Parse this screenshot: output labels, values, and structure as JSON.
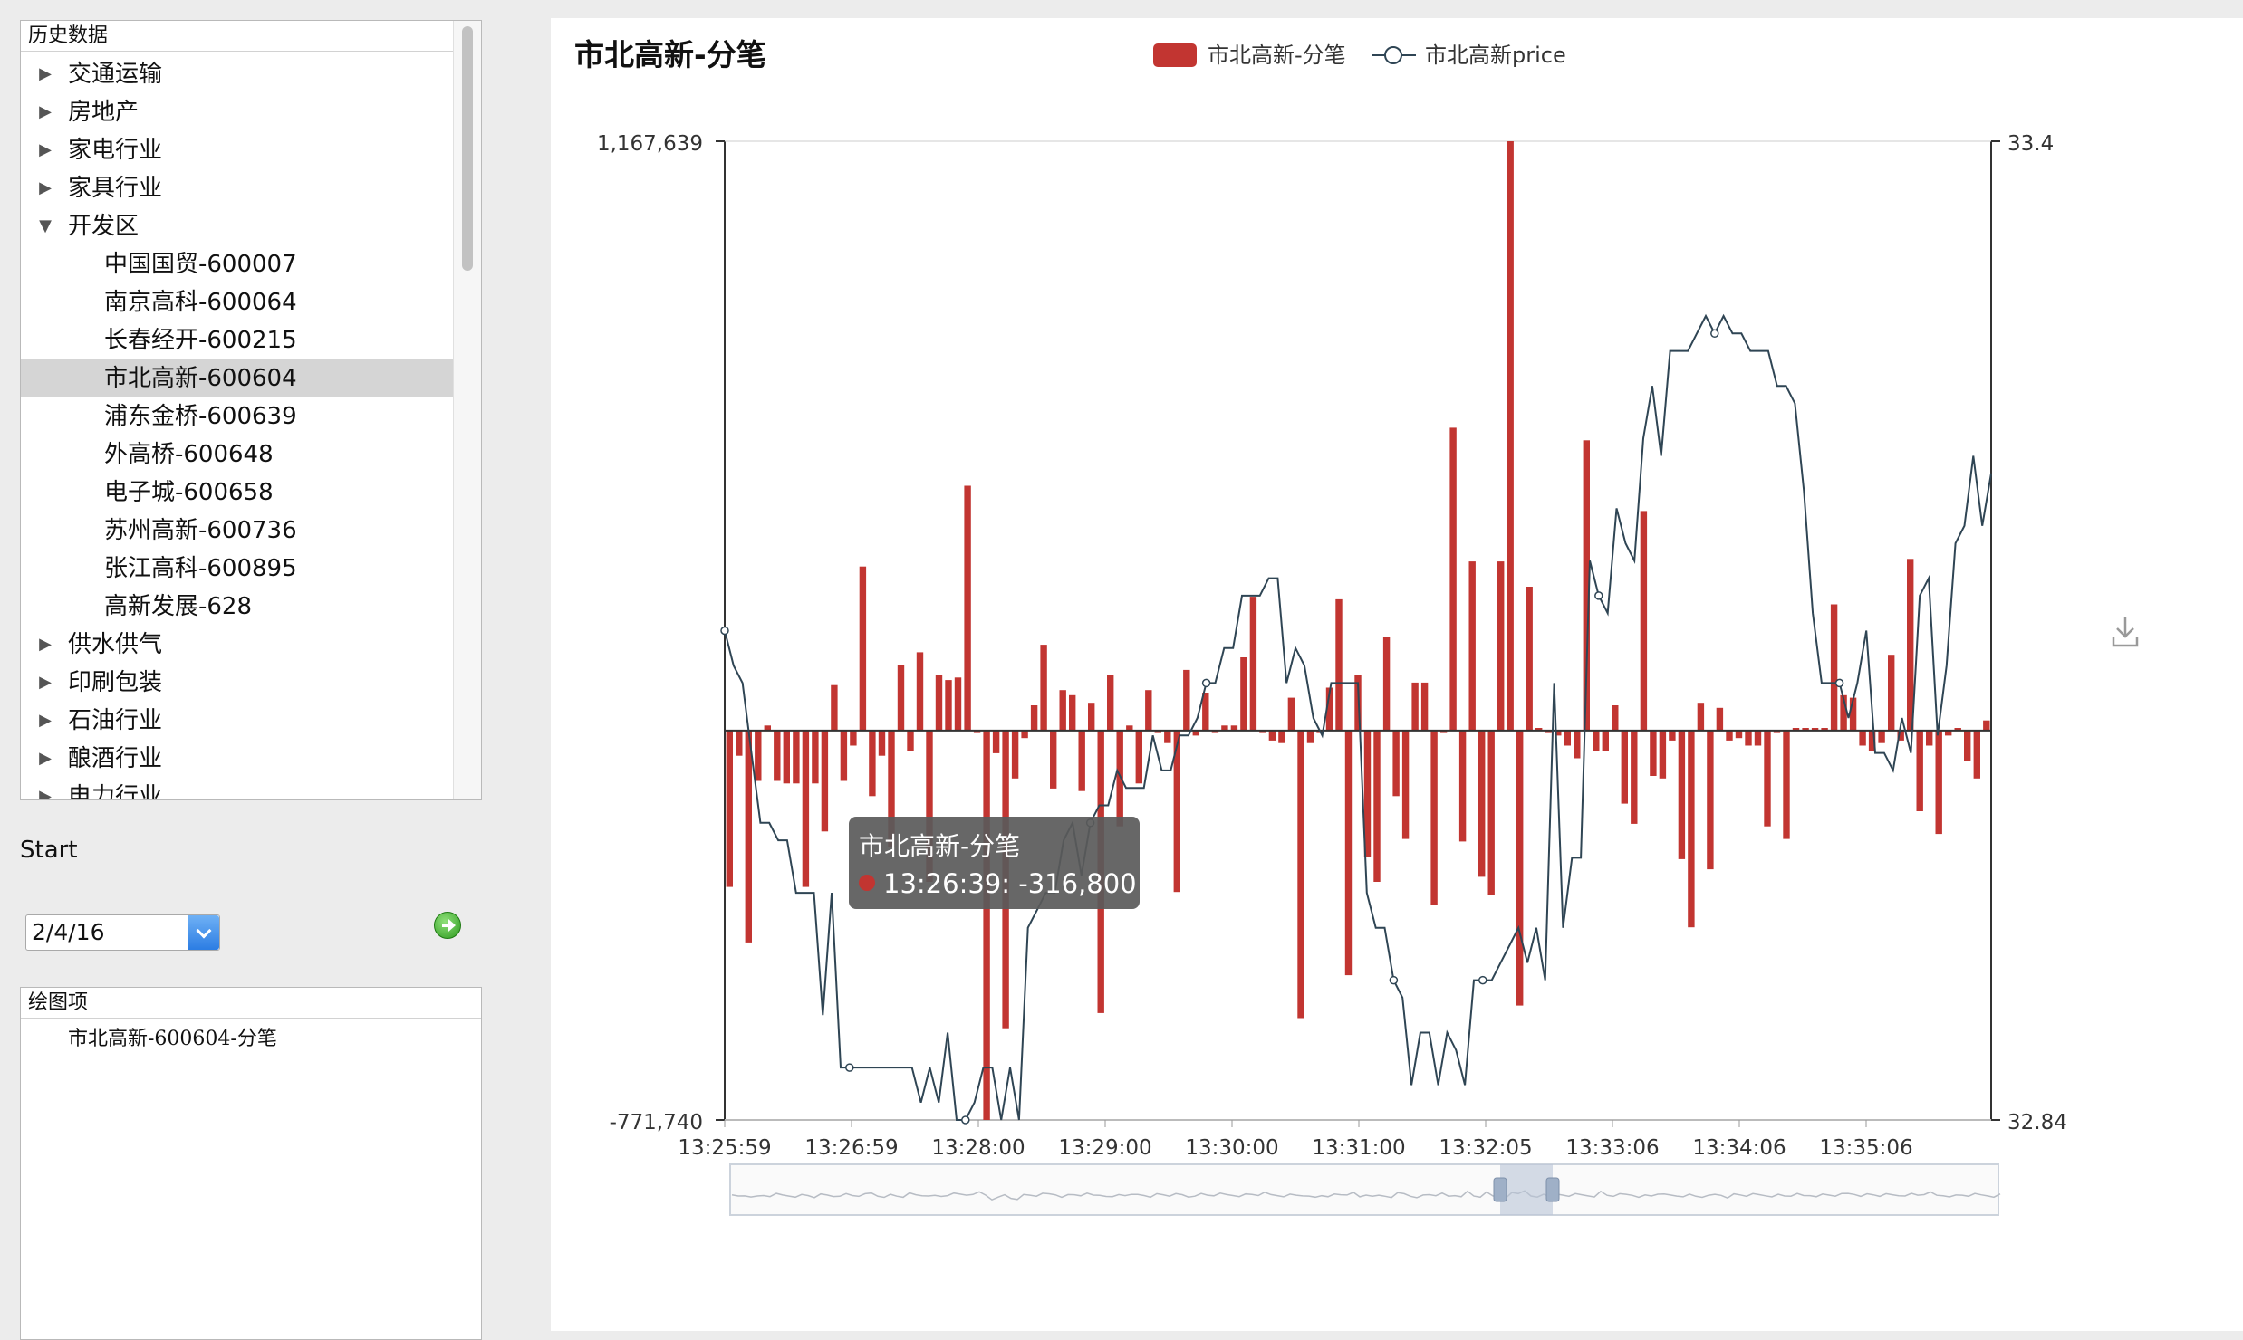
{
  "tree": {
    "header": "历史数据",
    "items": [
      {
        "label": "交通运输",
        "expanded": false
      },
      {
        "label": "房地产",
        "expanded": false
      },
      {
        "label": "家电行业",
        "expanded": false
      },
      {
        "label": "家具行业",
        "expanded": false
      },
      {
        "label": "开发区",
        "expanded": true
      },
      {
        "label": "中国国贸-600007",
        "child": true
      },
      {
        "label": "南京高科-600064",
        "child": true
      },
      {
        "label": "长春经开-600215",
        "child": true
      },
      {
        "label": "市北高新-600604",
        "child": true,
        "selected": true
      },
      {
        "label": "浦东金桥-600639",
        "child": true
      },
      {
        "label": "外高桥-600648",
        "child": true
      },
      {
        "label": "电子城-600658",
        "child": true
      },
      {
        "label": "苏州高新-600736",
        "child": true
      },
      {
        "label": "张江高科-600895",
        "child": true
      },
      {
        "label": "高新发展-628",
        "child": true
      },
      {
        "label": "供水供气",
        "expanded": false
      },
      {
        "label": "印刷包装",
        "expanded": false
      },
      {
        "label": "石油行业",
        "expanded": false
      },
      {
        "label": "酿酒行业",
        "expanded": false
      },
      {
        "label": "电力行业",
        "expanded": false
      }
    ]
  },
  "start": {
    "label": "Start",
    "date": "2/4/16"
  },
  "plot_items": {
    "header": "绘图项",
    "items": [
      "市北高新-600604-分笔"
    ]
  },
  "icons": {
    "download": "download-icon",
    "go": "go-arrow-icon",
    "tree_expand": "triangle-right-icon",
    "tree_collapse": "triangle-down-icon"
  },
  "colors": {
    "bar": "#c23531",
    "price_line": "#2f4554",
    "tooltip_bg": "#5a5a5a"
  },
  "tooltip": {
    "title": "市北高新-分笔",
    "text": "13:26:39: -316,800"
  },
  "chart_data": {
    "type": "bar",
    "title": "市北高新-分笔",
    "legend": {
      "position": "top-center",
      "entries": [
        "市北高新-分笔",
        "市北高新price"
      ]
    },
    "x_tick_labels": [
      "13:25:59",
      "13:26:59",
      "13:28:00",
      "13:29:00",
      "13:30:00",
      "13:31:00",
      "13:32:05",
      "13:33:06",
      "13:34:06",
      "13:35:06"
    ],
    "ylim_left": [
      -771740,
      1167639
    ],
    "ylim_right": [
      32.84,
      33.4
    ],
    "ytick_left": [
      "1,167,639",
      "-771,740"
    ],
    "ytick_right": [
      "33.4",
      "32.84"
    ],
    "series": [
      {
        "name": "市北高新-分笔",
        "type": "bar",
        "axis": "left",
        "values": [
          -310000,
          -50000,
          -420000,
          -100000,
          10000,
          -100000,
          -105000,
          -105000,
          -310000,
          -105000,
          -200000,
          90000,
          -100000,
          -30000,
          325000,
          -130000,
          -50000,
          -230000,
          130000,
          -40000,
          155000,
          -300000,
          110000,
          100000,
          105000,
          485000,
          -5000,
          -771740,
          -45000,
          -590000,
          -95000,
          -15000,
          50000,
          170000,
          -115000,
          80000,
          70000,
          -120000,
          55000,
          -560000,
          110000,
          -190000,
          10000,
          -105000,
          80000,
          -5000,
          -25000,
          -320000,
          120000,
          -10000,
          75000,
          -5000,
          10000,
          10000,
          145000,
          265000,
          -5000,
          -20000,
          -25000,
          65000,
          -570000,
          -25000,
          -5000,
          85000,
          260000,
          -485000,
          110000,
          -250000,
          -300000,
          185000,
          -130000,
          -215000,
          95000,
          95000,
          -345000,
          -5000,
          600000,
          -220000,
          335000,
          -290000,
          -325000,
          335000,
          1167639,
          -545000,
          285000,
          5000,
          -5000,
          -10000,
          -30000,
          -55000,
          575000,
          -40000,
          -40000,
          50000,
          -145000,
          -185000,
          435000,
          -90000,
          -95000,
          -20000,
          -255000,
          -390000,
          55000,
          -275000,
          45000,
          -20000,
          -15000,
          -30000,
          -30000,
          -190000,
          -5000,
          -215000,
          5000,
          5000,
          5000,
          5000,
          250000,
          70000,
          65000,
          -30000,
          -40000,
          -25000,
          150000,
          -20000,
          340000,
          -160000,
          -30000,
          -205000,
          -10000,
          5000,
          -60000,
          -95000,
          20000
        ]
      },
      {
        "name": "市北高新price",
        "type": "line",
        "axis": "right",
        "values": [
          33.12,
          33.1,
          33.09,
          33.05,
          33.01,
          33.01,
          33.0,
          33.0,
          32.97,
          32.97,
          32.97,
          32.9,
          32.97,
          32.87,
          32.87,
          32.87,
          32.87,
          32.87,
          32.87,
          32.87,
          32.87,
          32.87,
          32.85,
          32.87,
          32.85,
          32.89,
          32.84,
          32.84,
          32.85,
          32.87,
          32.87,
          32.84,
          32.87,
          32.84,
          32.95,
          32.96,
          32.97,
          32.97,
          33.0,
          33.01,
          32.98,
          33.01,
          33.02,
          33.02,
          33.04,
          33.03,
          33.03,
          33.03,
          33.06,
          33.04,
          33.04,
          33.06,
          33.06,
          33.07,
          33.09,
          33.09,
          33.11,
          33.11,
          33.14,
          33.14,
          33.14,
          33.15,
          33.15,
          33.09,
          33.11,
          33.1,
          33.07,
          33.06,
          33.09,
          33.09,
          33.09,
          33.09,
          32.97,
          32.95,
          32.95,
          32.92,
          32.91,
          32.86,
          32.89,
          32.89,
          32.86,
          32.89,
          32.88,
          32.86,
          32.92,
          32.92,
          32.92,
          32.93,
          32.94,
          32.95,
          32.93,
          32.95,
          32.92,
          33.09,
          32.95,
          32.99,
          32.99,
          33.16,
          33.14,
          33.13,
          33.19,
          33.17,
          33.16,
          33.23,
          33.26,
          33.22,
          33.28,
          33.28,
          33.28,
          33.29,
          33.3,
          33.29,
          33.3,
          33.29,
          33.29,
          33.28,
          33.28,
          33.28,
          33.26,
          33.26,
          33.25,
          33.2,
          33.13,
          33.09,
          33.09,
          33.09,
          33.07,
          33.09,
          33.12,
          33.05,
          33.05,
          33.04,
          33.07,
          33.05,
          33.14,
          33.15,
          33.06,
          33.1,
          33.17,
          33.18,
          33.22,
          33.18,
          33.21
        ]
      }
    ]
  }
}
